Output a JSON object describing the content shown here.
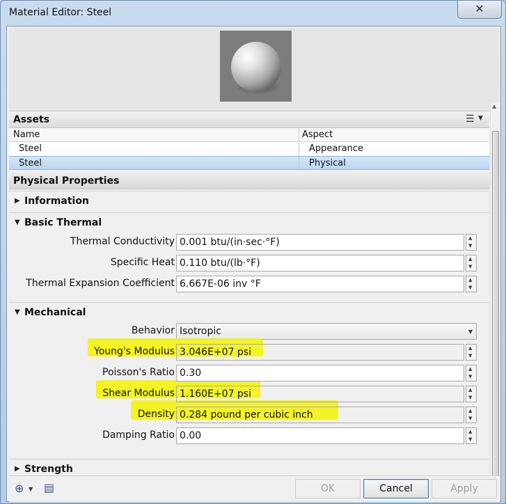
{
  "window": {
    "title": "Material Editor: Steel",
    "close_label": "✕"
  },
  "assets": {
    "header": "Assets",
    "columns": {
      "name": "Name",
      "aspect": "Aspect"
    },
    "rows": [
      {
        "name": "Steel",
        "aspect": "Appearance",
        "selected": false
      },
      {
        "name": "Steel",
        "aspect": "Physical",
        "selected": true
      }
    ]
  },
  "physical": {
    "header": "Physical Properties",
    "sections": {
      "information": {
        "label": "Information",
        "expanded": false
      },
      "basic_thermal": {
        "label": "Basic Thermal",
        "expanded": true,
        "fields": [
          {
            "label": "Thermal Conductivity",
            "value": "0.001 btu/(in·sec·°F)"
          },
          {
            "label": "Specific Heat",
            "value": "0.110 btu/(lb·°F)"
          },
          {
            "label": "Thermal Expansion Coefficient",
            "value": "6.667E-06 inv °F"
          }
        ]
      },
      "mechanical": {
        "label": "Mechanical",
        "expanded": true,
        "behavior": {
          "label": "Behavior",
          "value": "Isotropic"
        },
        "fields": [
          {
            "label": "Young's Modulus",
            "value": "3.046E+07 psi",
            "highlighted": true
          },
          {
            "label": "Poisson's Ratio",
            "value": "0.30",
            "highlighted": false
          },
          {
            "label": "Shear Modulus",
            "value": "1.160E+07 psi",
            "highlighted": true
          },
          {
            "label": "Density",
            "value": "0.284 pound per cubic inch",
            "highlighted": true
          },
          {
            "label": "Damping Ratio",
            "value": "0.00",
            "highlighted": false
          }
        ]
      },
      "strength": {
        "label": "Strength",
        "expanded": false
      }
    }
  },
  "buttons": {
    "ok": "OK",
    "cancel": "Cancel",
    "apply": "Apply"
  },
  "icons": {
    "add_asset": "add-asset-icon",
    "asset_browser": "asset-browser-icon",
    "list_view": "list-view-icon"
  },
  "colors": {
    "highlight": "#f4f315",
    "selection": "#bcd6f1",
    "title_bar": "#c9dcef"
  }
}
